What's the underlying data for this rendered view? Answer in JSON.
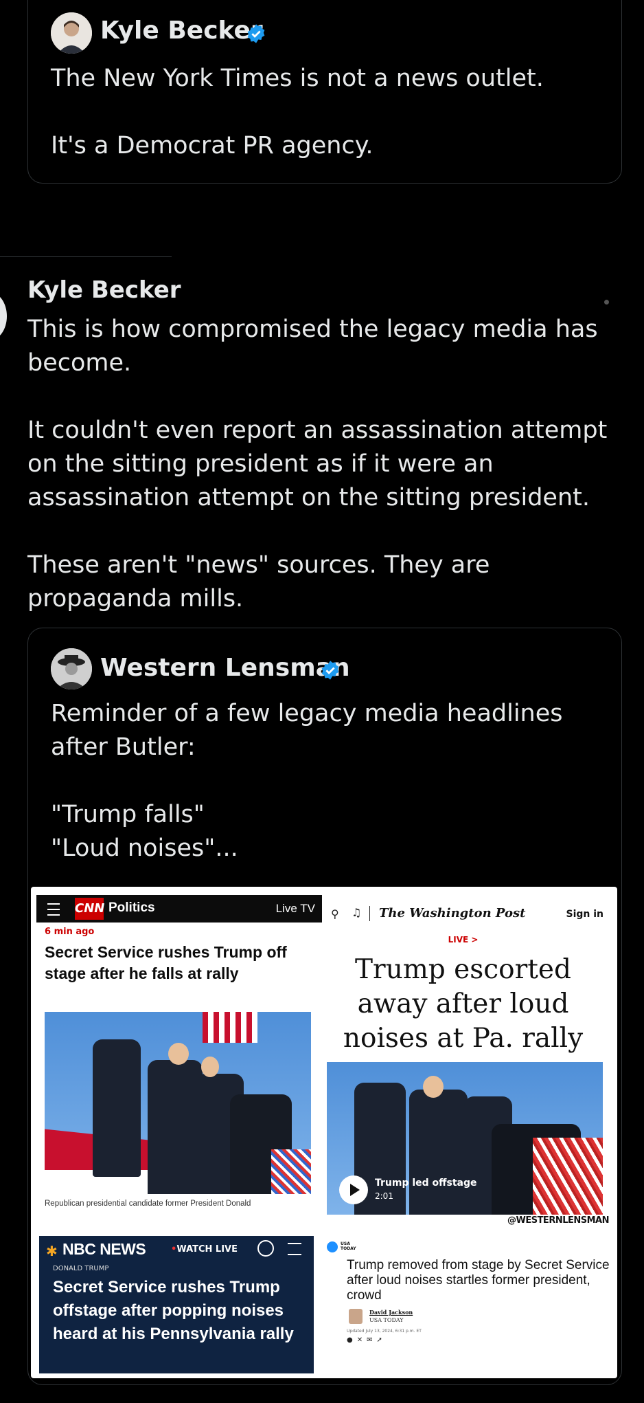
{
  "tweet1": {
    "author": "Kyle Becker",
    "lines": [
      "The New York Times is not a news outlet.",
      "It's a Democrat PR agency."
    ]
  },
  "tweet2": {
    "author": "Kyle Becker",
    "paragraphs": [
      "This is how compromised the legacy media has become.",
      "It couldn't even report an assassination attempt on the sitting president as if it were an assassination attempt on the sitting president.",
      "These aren't \"news\" sources. They are propaganda mills."
    ]
  },
  "quote": {
    "author": "Western Lensman",
    "lines": [
      "Reminder of a few legacy media headlines after Butler:",
      "\"Trump falls\"",
      "\"Loud noises\"..."
    ]
  },
  "image": {
    "cnn": {
      "logo": "CNN",
      "section": "Politics",
      "live_tv": "Live TV",
      "time": "6 min ago",
      "headline": "Secret Service rushes Trump off stage after he falls at rally",
      "caption": "Republican presidential candidate former President Donald"
    },
    "wapo": {
      "masthead": "The Washington Post",
      "sign_in": "Sign in",
      "live": "LIVE >",
      "headline": "Trump escorted away after loud noises at Pa. rally",
      "video_title": "Trump led offstage",
      "video_time": "2:01",
      "watermark": "@WESTERNLENSMAN"
    },
    "nbc": {
      "logo": "NBC NEWS",
      "watch_live": "WATCH LIVE",
      "kicker": "DONALD TRUMP",
      "headline": "Secret Service rushes Trump offstage after popping noises heard at his Pennsylvania rally"
    },
    "usatoday": {
      "logo": "USA TODAY",
      "headline": "Trump removed from stage by Secret Service after loud noises startles former president, crowd",
      "author": "David Jackson",
      "outlet": "USA TODAY",
      "updated": "Updated July 13, 2024, 6:31 p.m. ET"
    }
  },
  "colors": {
    "verified": "#1d9bf0",
    "border": "#2f3336",
    "cnn_red": "#cc0000",
    "nbc_navy": "#0f2341"
  }
}
